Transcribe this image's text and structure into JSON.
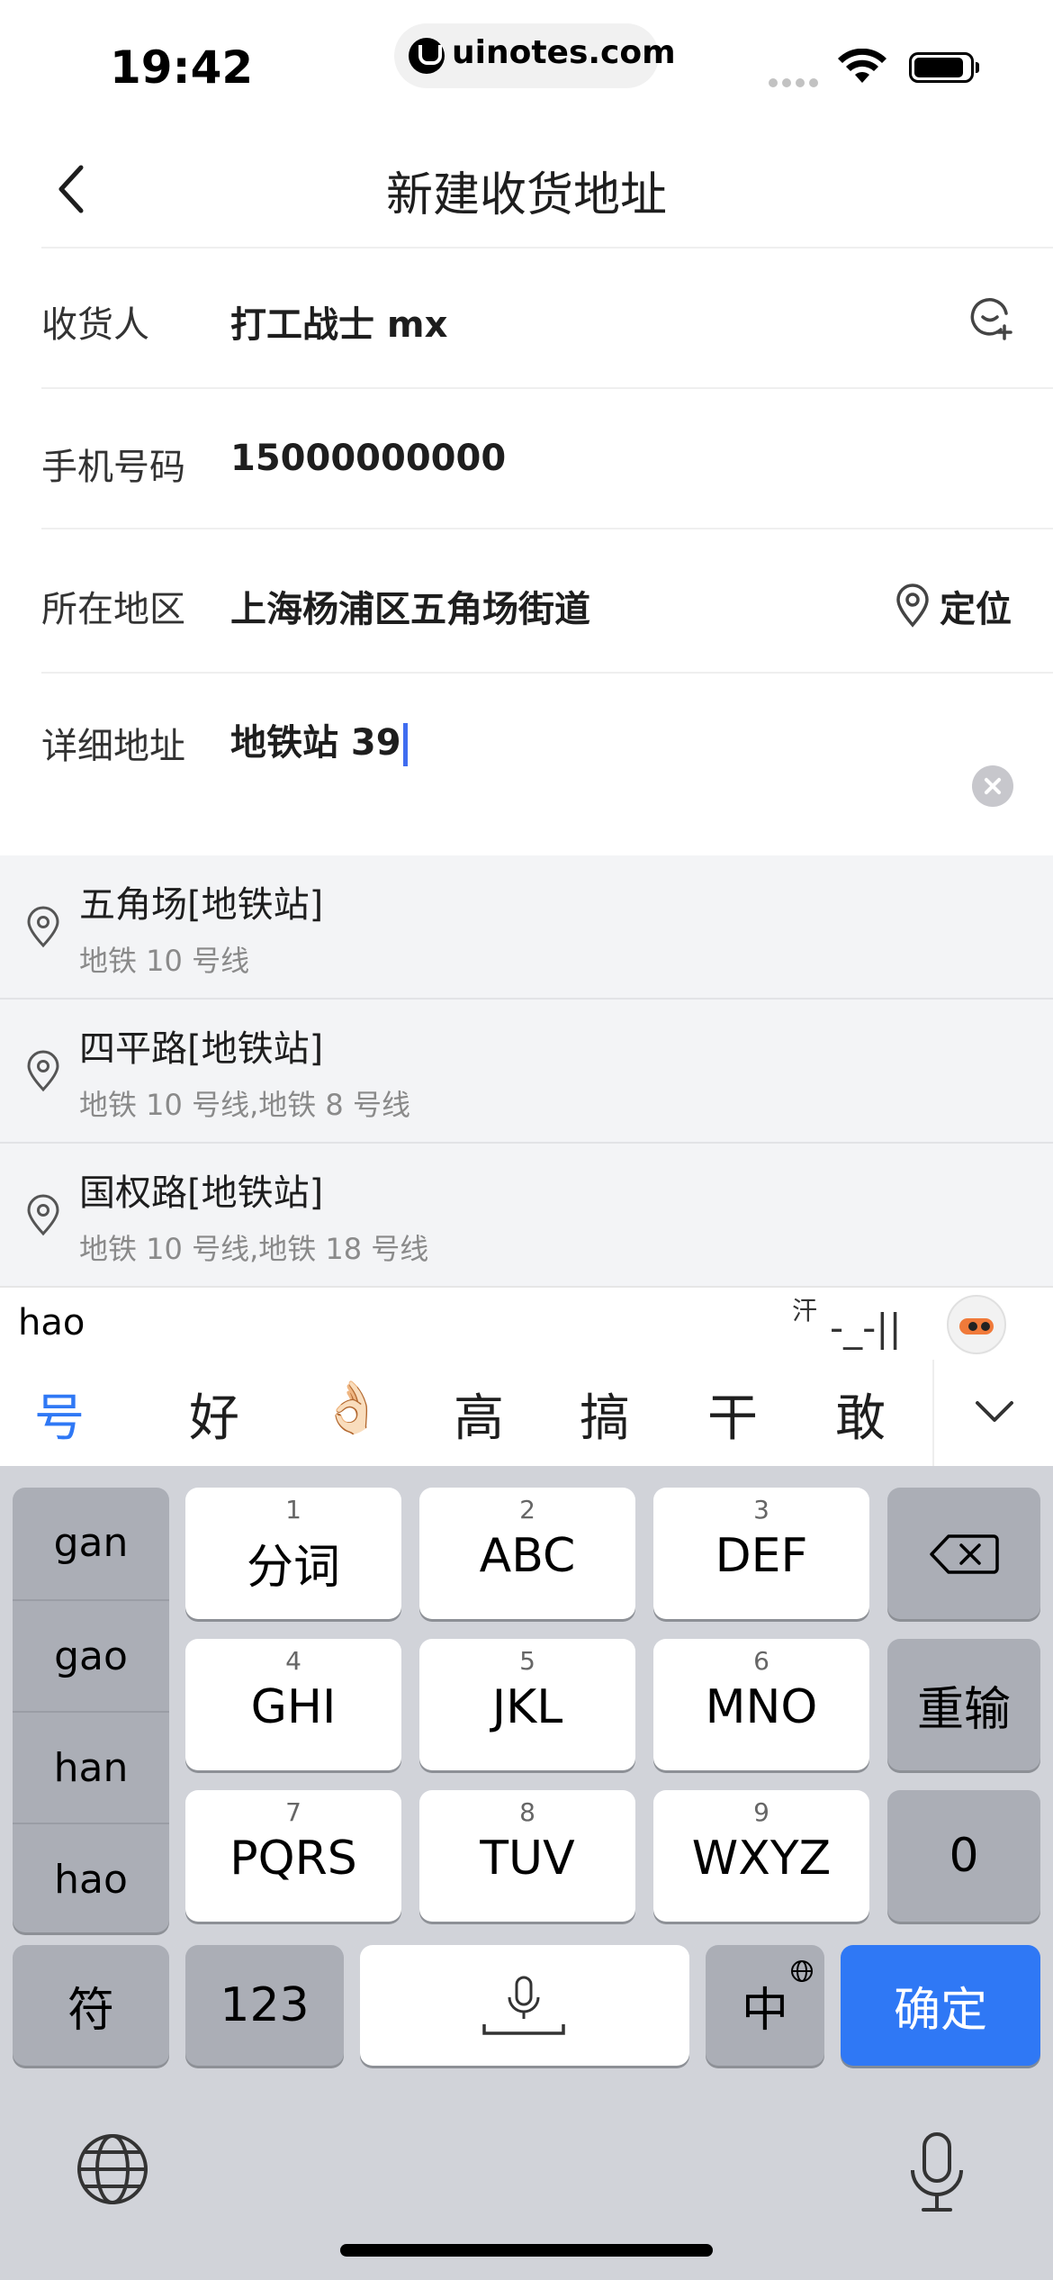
{
  "status_bar": {
    "time": "19:42",
    "url": "uinotes.com"
  },
  "nav": {
    "title": "新建收货地址"
  },
  "form": {
    "recipient": {
      "label": "收货人",
      "value": "打工战士 mx"
    },
    "phone": {
      "label": "手机号码",
      "value": "15000000000"
    },
    "region": {
      "label": "所在地区",
      "value": "上海杨浦区五角场街道",
      "locate_label": "定位"
    },
    "detail": {
      "label": "详细地址",
      "value": "地铁站 39"
    }
  },
  "suggestions": [
    {
      "name": "五角场[地铁站]",
      "sub": "地铁 10 号线"
    },
    {
      "name": "四平路[地铁站]",
      "sub": "地铁 10 号线,地铁 8 号线"
    },
    {
      "name": "国权路[地铁站]",
      "sub": "地铁 10 号线,地铁 18 号线"
    }
  ],
  "ime": {
    "composition": "hao",
    "emote_prefix": "汗",
    "emote": "-_-||",
    "candidates": [
      "号",
      "好",
      "👌🏻",
      "高",
      "搞",
      "干",
      "敢"
    ],
    "pinyin_options": [
      "gan",
      "gao",
      "han",
      "hao"
    ]
  },
  "keyboard": {
    "keys": [
      {
        "num": "1",
        "label": "分词"
      },
      {
        "num": "2",
        "label": "ABC"
      },
      {
        "num": "3",
        "label": "DEF"
      },
      {
        "num": "4",
        "label": "GHI"
      },
      {
        "num": "5",
        "label": "JKL"
      },
      {
        "num": "6",
        "label": "MNO"
      },
      {
        "num": "7",
        "label": "PQRS"
      },
      {
        "num": "8",
        "label": "TUV"
      },
      {
        "num": "9",
        "label": "WXYZ"
      }
    ],
    "reinput": "重输",
    "zero": "0",
    "symbol": "符",
    "num_mode": "123",
    "lang": "中",
    "confirm": "确定"
  },
  "colors": {
    "accent": "#2f78f5",
    "caret": "#3f6cf0",
    "keyboard_bg": "#d1d3d9"
  }
}
